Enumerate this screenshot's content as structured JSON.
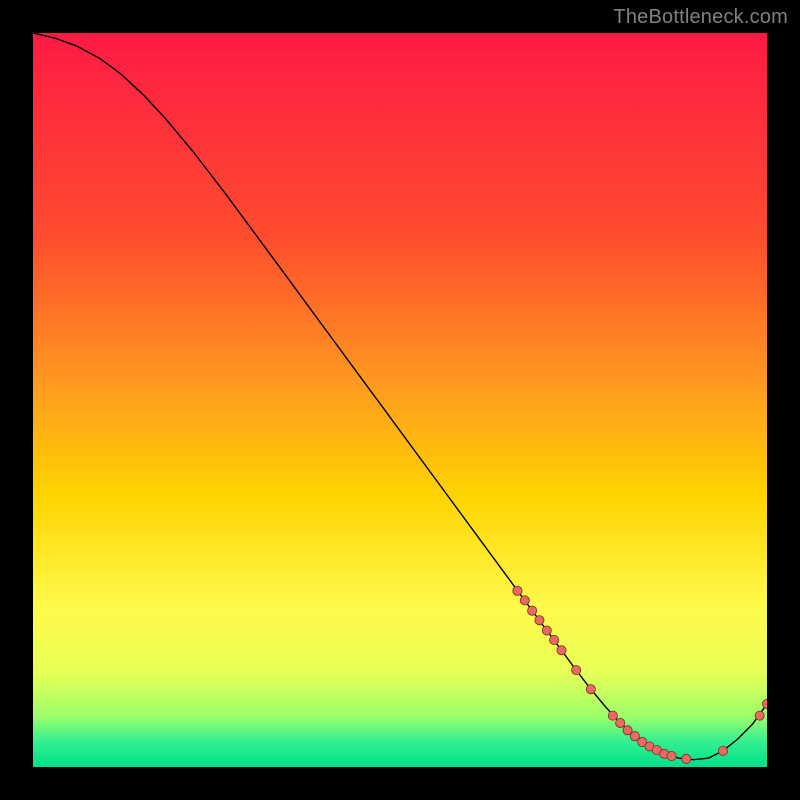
{
  "watermark": "TheBottleneck.com",
  "colors": {
    "gradient_top": "#ff1a44",
    "gradient_mid1": "#ff6a2a",
    "gradient_mid2": "#ffd400",
    "gradient_mid3": "#fff94a",
    "gradient_low": "#9eff6a",
    "gradient_bottom": "#00e08a",
    "curve": "#000000",
    "marker": "#e96a60",
    "marker_stroke": "#7a2e28"
  },
  "chart_data": {
    "type": "line",
    "title": "",
    "xlabel": "",
    "ylabel": "",
    "xlim": [
      0,
      100
    ],
    "ylim": [
      0,
      100
    ],
    "curve": {
      "x": [
        0,
        3,
        6,
        9,
        12,
        15,
        18,
        22,
        26,
        30,
        35,
        40,
        45,
        50,
        55,
        60,
        65,
        70,
        72,
        74,
        76,
        78,
        80,
        82,
        84,
        86,
        88,
        90,
        92,
        94,
        96,
        98,
        100
      ],
      "y": [
        100,
        99.3,
        98.2,
        96.6,
        94.4,
        91.6,
        88.4,
        83.6,
        78.4,
        73.0,
        66.2,
        59.4,
        52.6,
        45.8,
        39.0,
        32.2,
        25.4,
        18.6,
        15.9,
        13.2,
        10.6,
        8.2,
        6.0,
        4.2,
        2.8,
        1.8,
        1.2,
        1.0,
        1.2,
        2.2,
        3.8,
        5.8,
        8.6
      ]
    },
    "markers": [
      {
        "x": 66,
        "y": 24.0
      },
      {
        "x": 67,
        "y": 22.7
      },
      {
        "x": 68,
        "y": 21.3
      },
      {
        "x": 69,
        "y": 20.0
      },
      {
        "x": 70,
        "y": 18.6
      },
      {
        "x": 71,
        "y": 17.3
      },
      {
        "x": 72,
        "y": 15.9
      },
      {
        "x": 74,
        "y": 13.2
      },
      {
        "x": 76,
        "y": 10.6
      },
      {
        "x": 79,
        "y": 7.0
      },
      {
        "x": 80,
        "y": 6.0
      },
      {
        "x": 81,
        "y": 5.0
      },
      {
        "x": 82,
        "y": 4.2
      },
      {
        "x": 83,
        "y": 3.4
      },
      {
        "x": 84,
        "y": 2.8
      },
      {
        "x": 85,
        "y": 2.3
      },
      {
        "x": 86,
        "y": 1.8
      },
      {
        "x": 87,
        "y": 1.5
      },
      {
        "x": 89,
        "y": 1.1
      },
      {
        "x": 94,
        "y": 2.2
      },
      {
        "x": 99,
        "y": 7.0
      },
      {
        "x": 100,
        "y": 8.6
      }
    ]
  }
}
